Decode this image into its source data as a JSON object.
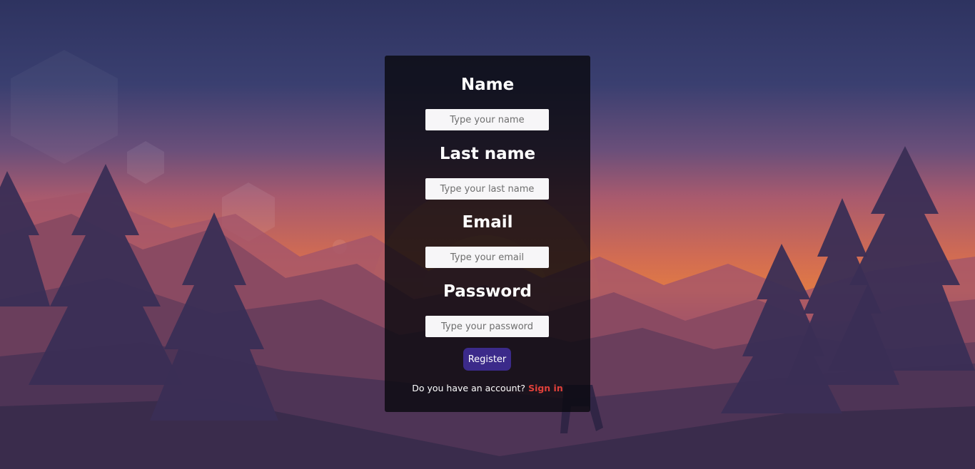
{
  "form": {
    "name_label": "Name",
    "name_placeholder": "Type your name",
    "lastname_label": "Last name",
    "lastname_placeholder": "Type your last name",
    "email_label": "Email",
    "email_placeholder": "Type your email",
    "password_label": "Password",
    "password_placeholder": "Type your password",
    "register_label": "Register",
    "account_prompt": "Do you have an account?",
    "signin_label": "Sign in"
  },
  "colors": {
    "card_bg": "#0a0a10",
    "register_bg": "#3b2a8a",
    "signin_link": "#e0403a",
    "input_bg": "#f7f6f8"
  }
}
